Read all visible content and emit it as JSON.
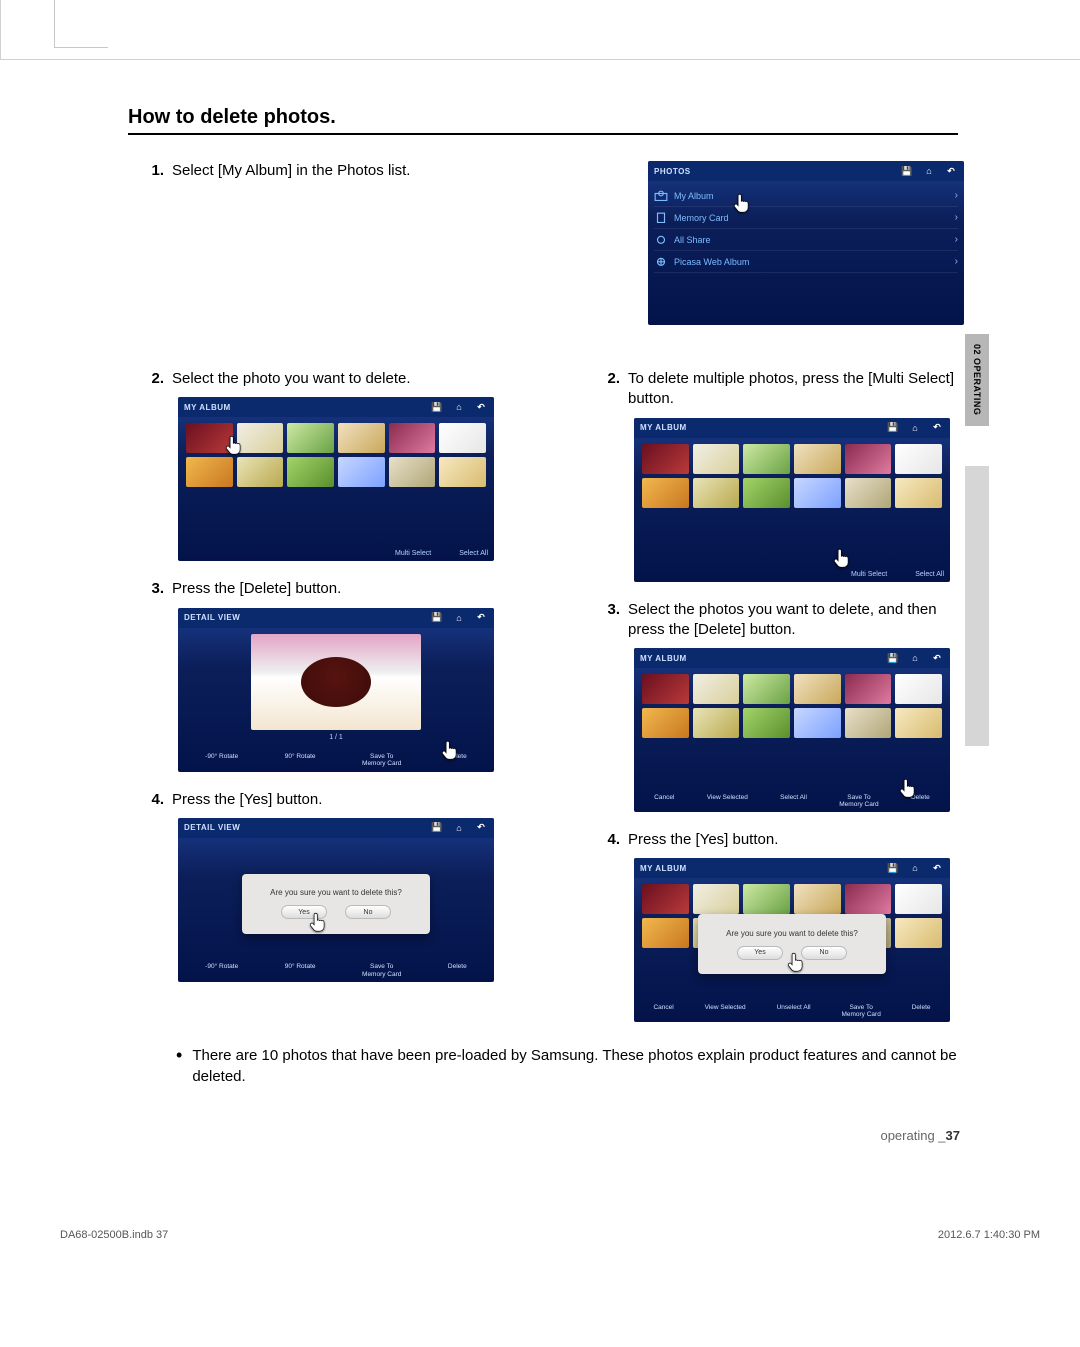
{
  "section_title": "How to delete photos.",
  "side_tab": "02  OPERATING",
  "left_col": {
    "step1": {
      "num": "1.",
      "text": "Select [My Album] in the Photos list."
    },
    "step2": {
      "num": "2.",
      "text": "Select the photo you want to delete."
    },
    "step3": {
      "num": "3.",
      "text": "Press the [Delete] button."
    },
    "step4": {
      "num": "4.",
      "text": "Press the [Yes] button."
    }
  },
  "right_col": {
    "step2": {
      "num": "2.",
      "text": "To delete multiple photos, press the [Multi Select] button."
    },
    "step3": {
      "num": "3.",
      "text": "Select the photos you want to delete, and then press the [Delete] button."
    },
    "step4": {
      "num": "4.",
      "text": "Press the [Yes] button."
    }
  },
  "note_bullet": "There are 10 photos that have been pre-loaded by Samsung. These photos explain product features and cannot be deleted.",
  "photos_list": {
    "header": "PHOTOS",
    "items": [
      "My Album",
      "Memory Card",
      "All Share",
      "Picasa Web Album"
    ]
  },
  "album": {
    "header": "MY ALBUM",
    "footer_multi": "Multi Select",
    "footer_selectall": "Select All",
    "footer_cancel": "Cancel",
    "footer_viewsel": "View Selected",
    "footer_unselectall": "Unselect All",
    "footer_saveto1": "Save To",
    "footer_saveto2": "Memory Card",
    "footer_delete": "Delete"
  },
  "detail": {
    "header": "DETAIL VIEW",
    "counter": "1 / 1",
    "btn_rotL": "-90° Rotate",
    "btn_rotR": "90° Rotate",
    "btn_save1": "Save To",
    "btn_save2": "Memory Card",
    "btn_delete": "Delete"
  },
  "dialog": {
    "text": "Are you sure you want to delete this?",
    "yes": "Yes",
    "no": "No"
  },
  "footer": {
    "text_label": "operating _",
    "page": "37"
  },
  "print_meta": {
    "left": "DA68-02500B.indb   37",
    "right": "2012.6.7   1:40:30 PM"
  }
}
